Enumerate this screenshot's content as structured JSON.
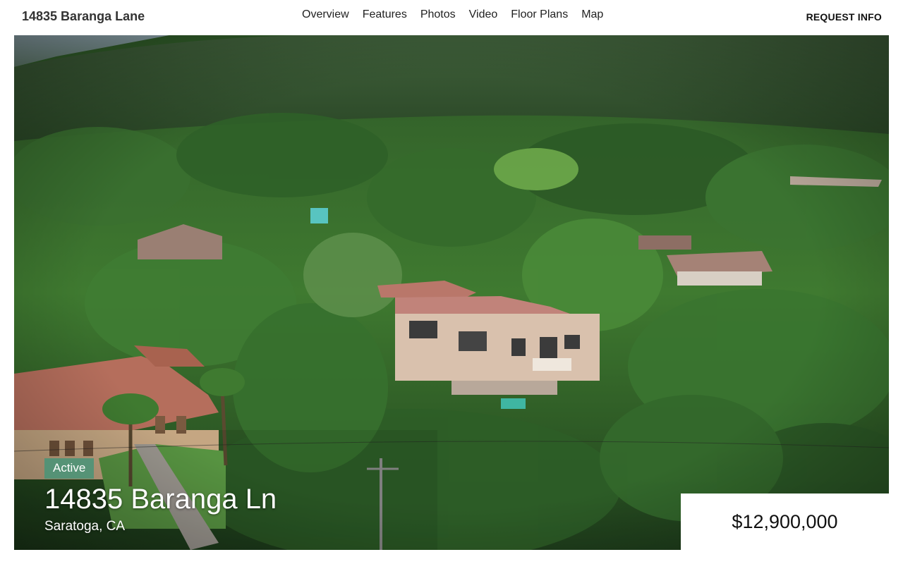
{
  "header": {
    "site_title": "14835 Baranga Lane",
    "nav": [
      "Overview",
      "Features",
      "Photos",
      "Video",
      "Floor Plans",
      "Map"
    ],
    "request_label": "REQUEST INFO"
  },
  "hero": {
    "status": "Active",
    "address": "14835 Baranga Ln",
    "city": "Saratoga, CA",
    "price": "$12,900,000"
  },
  "colors": {
    "status_badge": "#489478",
    "forest_dark": "#1f3b1f",
    "forest_mid": "#3d6b2a",
    "roof": "#b9776a"
  }
}
